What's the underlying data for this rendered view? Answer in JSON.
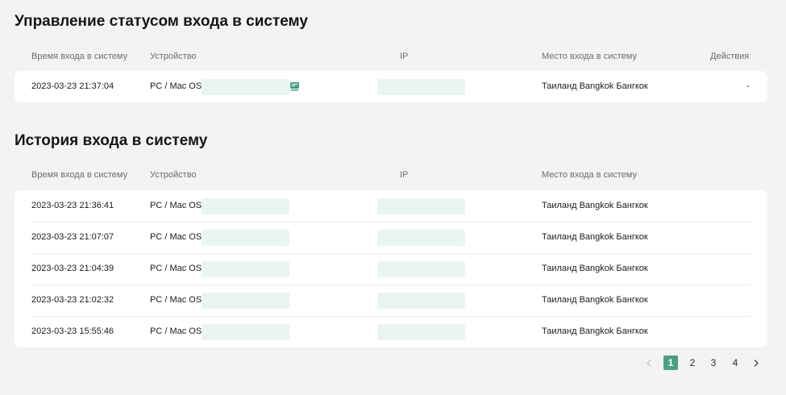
{
  "status_section": {
    "title": "Управление статусом входа в систему",
    "columns": {
      "time": "Время входа в систему",
      "device": "Устройство",
      "ip": "IP",
      "location": "Место входа в систему",
      "actions": "Действия"
    },
    "rows": [
      {
        "time": "2023-03-23 21:37:04",
        "device": "PC / Mac OS",
        "device_icon": "current-device-icon",
        "location": "Таиланд Bangkok Бангкок",
        "action": "-"
      }
    ]
  },
  "history_section": {
    "title": "История входа в систему",
    "columns": {
      "time": "Время входа в систему",
      "device": "Устройство",
      "ip": "IP",
      "location": "Место входа в систему"
    },
    "rows": [
      {
        "time": "2023-03-23 21:36:41",
        "device": "PC / Mac OS",
        "location": "Таиланд Bangkok Бангкок"
      },
      {
        "time": "2023-03-23 21:07:07",
        "device": "PC / Mac OS",
        "location": "Таиланд Bangkok Бангкок"
      },
      {
        "time": "2023-03-23 21:04:39",
        "device": "PC / Mac OS",
        "location": "Таиланд Bangkok Бангкок"
      },
      {
        "time": "2023-03-23 21:02:32",
        "device": "PC / Mac OS",
        "location": "Таиланд Bangkok Бангкок"
      },
      {
        "time": "2023-03-23 15:55:46",
        "device": "PC / Mac OS",
        "location": "Таиланд Bangkok Бангкок"
      }
    ]
  },
  "pagination": {
    "pages": [
      "1",
      "2",
      "3",
      "4"
    ],
    "current": "1",
    "prev_icon": "chevron-left-icon",
    "next_icon": "chevron-right-icon"
  },
  "colors": {
    "accent": "#4a9f86",
    "masked_field": "#e9f5f0",
    "background": "#f3f3f3",
    "card": "#ffffff"
  }
}
